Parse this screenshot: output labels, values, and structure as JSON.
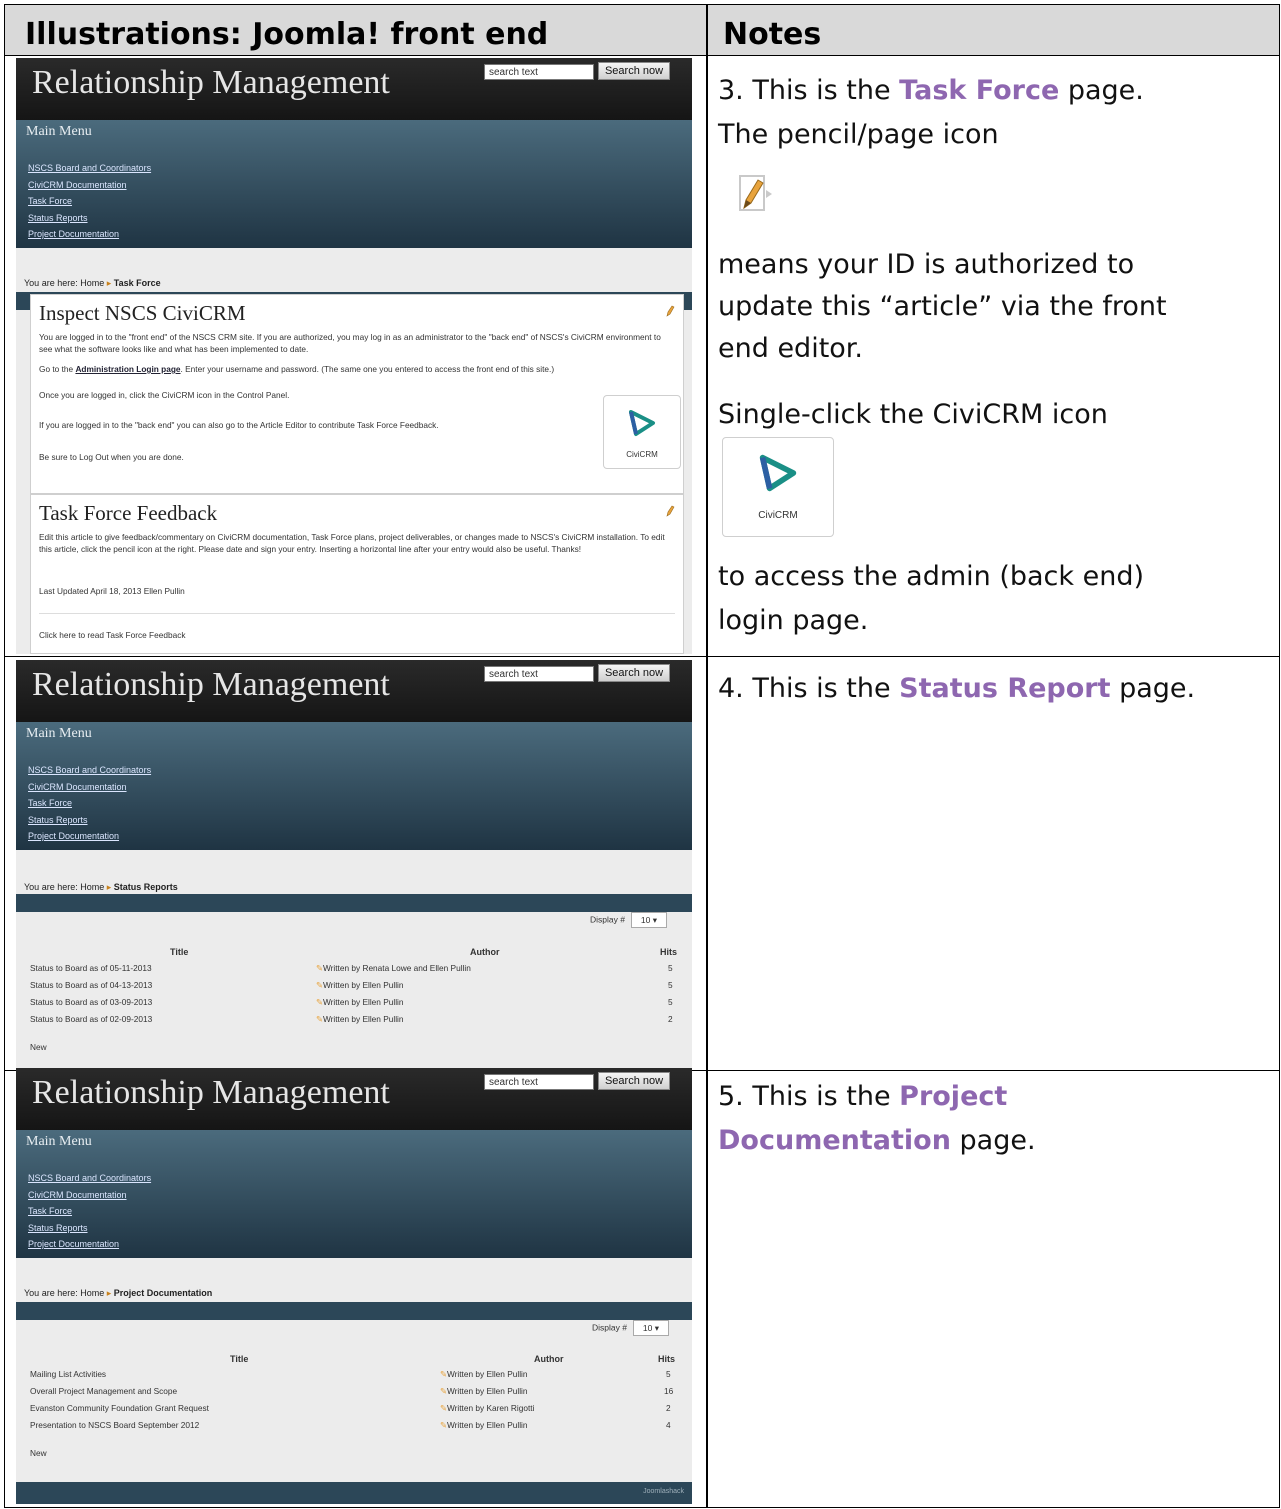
{
  "header": {
    "left": "Illustrations:  Joomla! front end",
    "right": "Notes"
  },
  "site": {
    "title": "Relationship Management",
    "search_placeholder": "search text",
    "search_button": "Search now",
    "menu_title": "Main Menu",
    "menu_items": [
      "NSCS Board and Coordinators",
      "CiviCRM Documentation",
      "Task Force",
      "Status Reports",
      "Project Documentation"
    ],
    "crumb_prefix": "You are here: ",
    "crumb_home": "Home",
    "civicrm_label": "CiviCRM",
    "display_label": "Display #",
    "display_value": "10",
    "col_title": "Title",
    "col_author": "Author",
    "col_hits": "Hits",
    "new_link": "New",
    "footer_mark": "Joomlashack"
  },
  "shot1": {
    "crumb_page": "Task Force",
    "article1_title": "Inspect NSCS CiviCRM",
    "article1_p1": "You are logged in to the \"front end\" of the NSCS CRM site.  If you are authorized, you may log in as an administrator to the \"back end\" of NSCS's CiviCRM environment to see what the software looks like and what has been implemented to date.",
    "article1_p2_a": "Go to the ",
    "article1_p2_link": "Administration Login page",
    "article1_p2_b": ".  Enter your username and password.  (The same one you entered to access the front end of this site.)",
    "article1_p3": "Once you are logged in, click the CiviCRM icon in the Control Panel.",
    "article1_p4": "If you are logged in to the \"back end\" you can also go to the Article Editor to contribute Task Force Feedback.",
    "article1_p5": "Be sure to Log Out when you are done.",
    "article2_title": "Task Force Feedback",
    "article2_p1": "Edit this article to give feedback/commentary on CiviCRM documentation, Task Force plans, project deliverables, or changes made to NSCS's CiviCRM installation.  To edit this article, click the pencil icon at the right.  Please date and sign your entry.  Inserting a horizontal line after your entry would also be useful.  Thanks!",
    "article2_p2": "Last Updated April 18, 2013 Ellen Pullin",
    "article2_p3": "Click here to read Task Force Feedback"
  },
  "shot2": {
    "crumb_page": "Status Reports",
    "rows": [
      {
        "title": "Status to Board as of 05-11-2013",
        "author": "Written by Renata Lowe and Ellen Pullin",
        "hits": "5"
      },
      {
        "title": "Status to Board as of 04-13-2013",
        "author": "Written by Ellen Pullin",
        "hits": "5"
      },
      {
        "title": "Status to Board as of 03-09-2013",
        "author": "Written by Ellen Pullin",
        "hits": "5"
      },
      {
        "title": "Status to Board as of 02-09-2013",
        "author": "Written by Ellen Pullin",
        "hits": "2"
      }
    ]
  },
  "shot3": {
    "crumb_page": "Project Documentation",
    "rows": [
      {
        "title": "Mailing List Activities",
        "author": "Written by Ellen Pullin",
        "hits": "5"
      },
      {
        "title": "Overall Project Management and Scope",
        "author": "Written by Ellen Pullin",
        "hits": "16"
      },
      {
        "title": "Evanston Community Foundation Grant Request",
        "author": "Written by Karen Rigotti",
        "hits": "2"
      },
      {
        "title": "Presentation to NSCS Board September 2012",
        "author": "Written by Ellen Pullin",
        "hits": "4"
      }
    ]
  },
  "notes": {
    "n3_a": "3. This is the ",
    "n3_accent": "Task Force",
    "n3_b": " page.",
    "n3_line2": "The pencil/page icon",
    "n3_line3": "means your ID is authorized to",
    "n3_line4": "update this “article” via the front",
    "n3_line5": "end editor.",
    "n3_line6": "Single-click the CiviCRM icon",
    "n3_line7": "to access the admin (back end)",
    "n3_line8": "login page.",
    "n4_a": "4. This is the ",
    "n4_accent": "Status Report",
    "n4_b": " page.",
    "n5_a": "5. This is the ",
    "n5_accent1": "Project",
    "n5_accent2": "Documentation",
    "n5_b": " page."
  }
}
